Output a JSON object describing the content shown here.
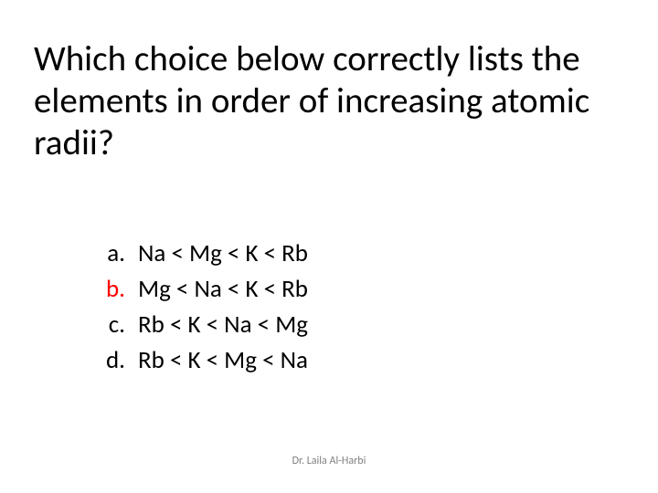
{
  "question": "Which choice below correctly lists the elements in order of increasing atomic radii?",
  "answers": [
    {
      "label": "a.",
      "text": "Na < Mg < K < Rb",
      "correct": false
    },
    {
      "label": "b.",
      "text": "Mg < Na < K < Rb",
      "correct": true
    },
    {
      "label": "c.",
      "text": "Rb < K < Na < Mg",
      "correct": false
    },
    {
      "label": "d.",
      "text": "Rb < K < Mg < Na",
      "correct": false
    }
  ],
  "footer": "Dr. Laila Al-Harbi"
}
